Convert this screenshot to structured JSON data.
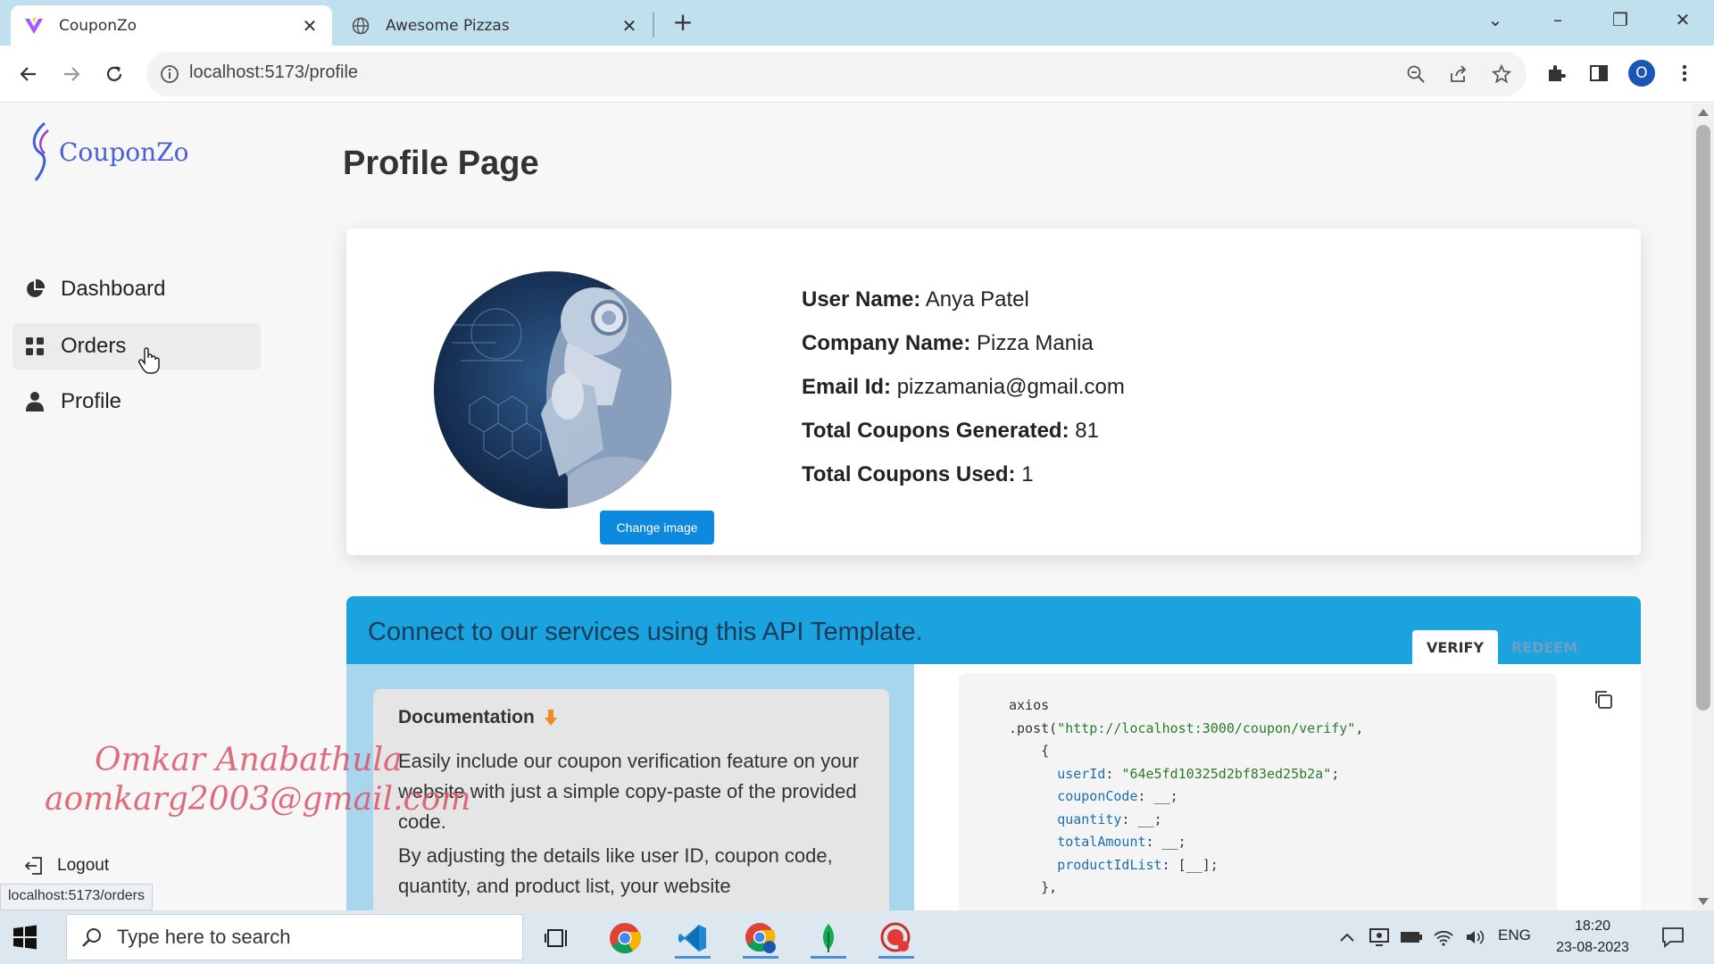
{
  "browser": {
    "tabs": [
      {
        "title": "CouponZo",
        "active": true
      },
      {
        "title": "Awesome Pizzas",
        "active": false
      }
    ],
    "url": "localhost:5173/profile",
    "profile_initial": "O",
    "status_url": "localhost:5173/orders"
  },
  "app": {
    "logo_text": "CouponZo",
    "nav": [
      {
        "label": "Dashboard",
        "icon": "pie-chart-icon"
      },
      {
        "label": "Orders",
        "icon": "grid-icon"
      },
      {
        "label": "Profile",
        "icon": "user-icon"
      }
    ],
    "logout_label": "Logout"
  },
  "page": {
    "title": "Profile Page",
    "change_image_label": "Change image",
    "fields": [
      {
        "key": "User Name:",
        "value": "Anya Patel"
      },
      {
        "key": "Company Name:",
        "value": "Pizza Mania"
      },
      {
        "key": "Email Id:",
        "value": "pizzamania@gmail.com"
      },
      {
        "key": "Total Coupons Generated:",
        "value": "81"
      },
      {
        "key": "Total Coupons Used:",
        "value": "1"
      }
    ]
  },
  "api": {
    "title": "Connect to our services using this API Template.",
    "tabs": [
      "VERIFY",
      "REDEEM"
    ],
    "doc_title": "Documentation",
    "doc_p1": "Easily include our coupon verification feature on your website with just a simple copy-paste of the provided code.",
    "doc_p2": "By adjusting the details like user ID, coupon code, quantity, and product list, your website",
    "code": {
      "line1": "axios",
      "post": ".post(",
      "endpoint": "\"http://localhost:3000/coupon/verify\"",
      "user_id_key": "userId",
      "user_id_value": "\"64e5fd10325d2bf83ed25b2a\"",
      "coupon_code_key": "couponCode",
      "quantity_key": "quantity",
      "total_amount_key": "totalAmount",
      "product_id_list_key": "productIdList",
      "blank": "__",
      "blank_list": "[__]"
    }
  },
  "watermark": {
    "line1": "Omkar Anabathula",
    "line2": "aomkarg2003@gmail.com"
  },
  "taskbar": {
    "search_placeholder": "Type here to search",
    "lang": "ENG",
    "time": "18:20",
    "date": "23-08-2023"
  },
  "colors": {
    "accent": "#1aa3df",
    "button": "#0d89e0",
    "logo": "#4b5fd4"
  }
}
